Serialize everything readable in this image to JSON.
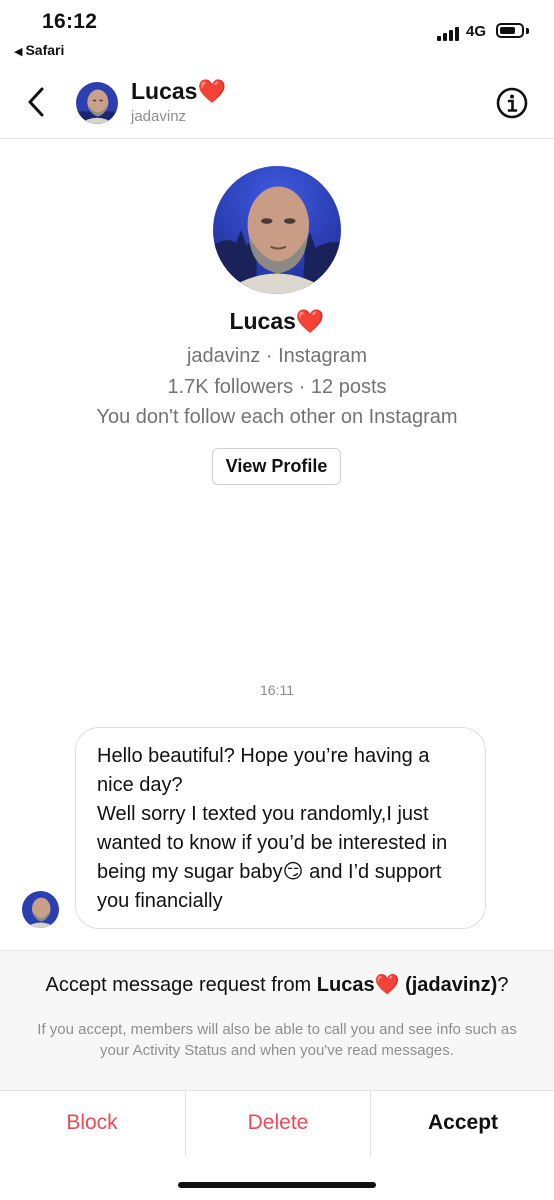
{
  "status_bar": {
    "time": "16:12",
    "back_app": "Safari",
    "network": "4G"
  },
  "header": {
    "name": "Lucas",
    "heart": "❤️",
    "username": "jadavinz"
  },
  "profile": {
    "name": "Lucas",
    "heart": "❤️",
    "username_line": "jadavinz · Instagram",
    "stats_line": "1.7K followers · 12 posts",
    "follow_line": "You don't follow each other on Instagram",
    "view_profile_label": "View Profile"
  },
  "conversation": {
    "timestamp": "16:11",
    "message": {
      "line1": "Hello beautiful? Hope you’re having a nice day?",
      "line2_before_emoji": "Well sorry I texted you randomly,I just wanted to know if you’d be interested in being my sugar baby",
      "emoji": "😏",
      "line2_after_emoji": " and I’d support you financially"
    }
  },
  "request": {
    "prefix": "Accept message request from ",
    "name": "Lucas",
    "heart": "❤️",
    "username_paren": "(jadavinz)",
    "suffix": "?",
    "note": "If you accept, members will also be able to call you and see info such as your Activity Status and when you've read messages."
  },
  "actions": {
    "block": "Block",
    "delete": "Delete",
    "accept": "Accept"
  },
  "colors": {
    "destructive": "#ed4956",
    "muted_text": "#8e8e8e",
    "avatar_sky": "#2c3fb0"
  }
}
